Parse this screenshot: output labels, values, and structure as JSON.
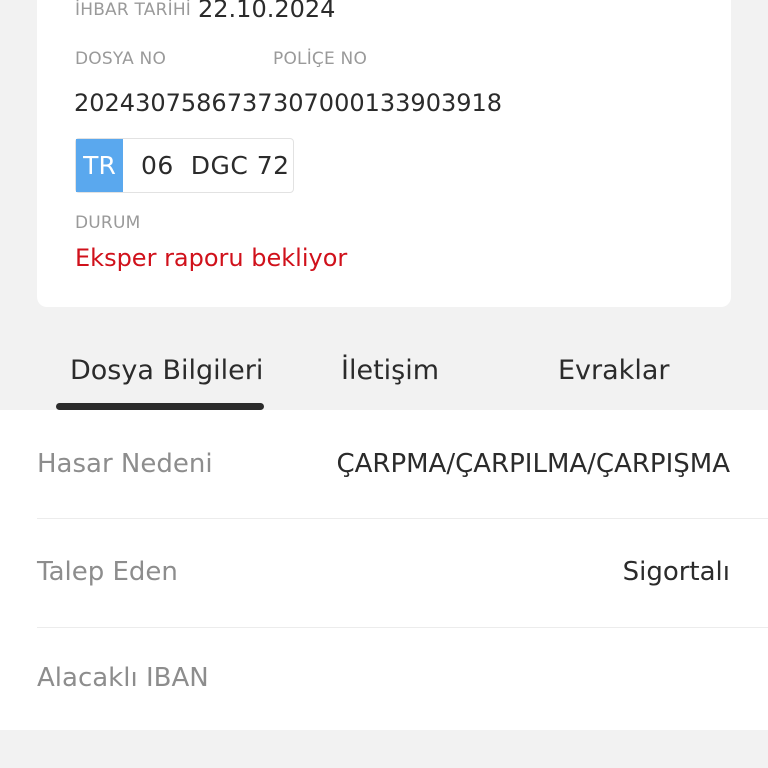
{
  "file_card": {
    "notice_date_label": "İHBAR TARİHİ",
    "notice_date_value": "22.10.2024",
    "file_no_label": "DOSYA NO",
    "file_no_value": "2024307586737",
    "policy_no_label": "POLİÇE NO",
    "policy_no_value": "307000133903918",
    "plate_country": "TR",
    "plate_number": "06  DGC 72",
    "status_label": "DURUM",
    "status_value": "Eksper raporu bekliyor"
  },
  "tabs": [
    {
      "label": "Dosya Bilgileri",
      "active": true
    },
    {
      "label": "İletişim",
      "active": false
    },
    {
      "label": "Evraklar",
      "active": false
    }
  ],
  "details": [
    {
      "key": "Hasar Nedeni",
      "value": "ÇARPMA/ÇARPILMA/ÇARPIŞMA"
    },
    {
      "key": "Talep Eden",
      "value": "Sigortalı"
    },
    {
      "key": "Alacaklı IBAN",
      "value": ""
    }
  ],
  "colors": {
    "plate_country_bg": "#5aa8ee",
    "status_text": "#d0111b",
    "page_bg": "#f2f2f2"
  }
}
